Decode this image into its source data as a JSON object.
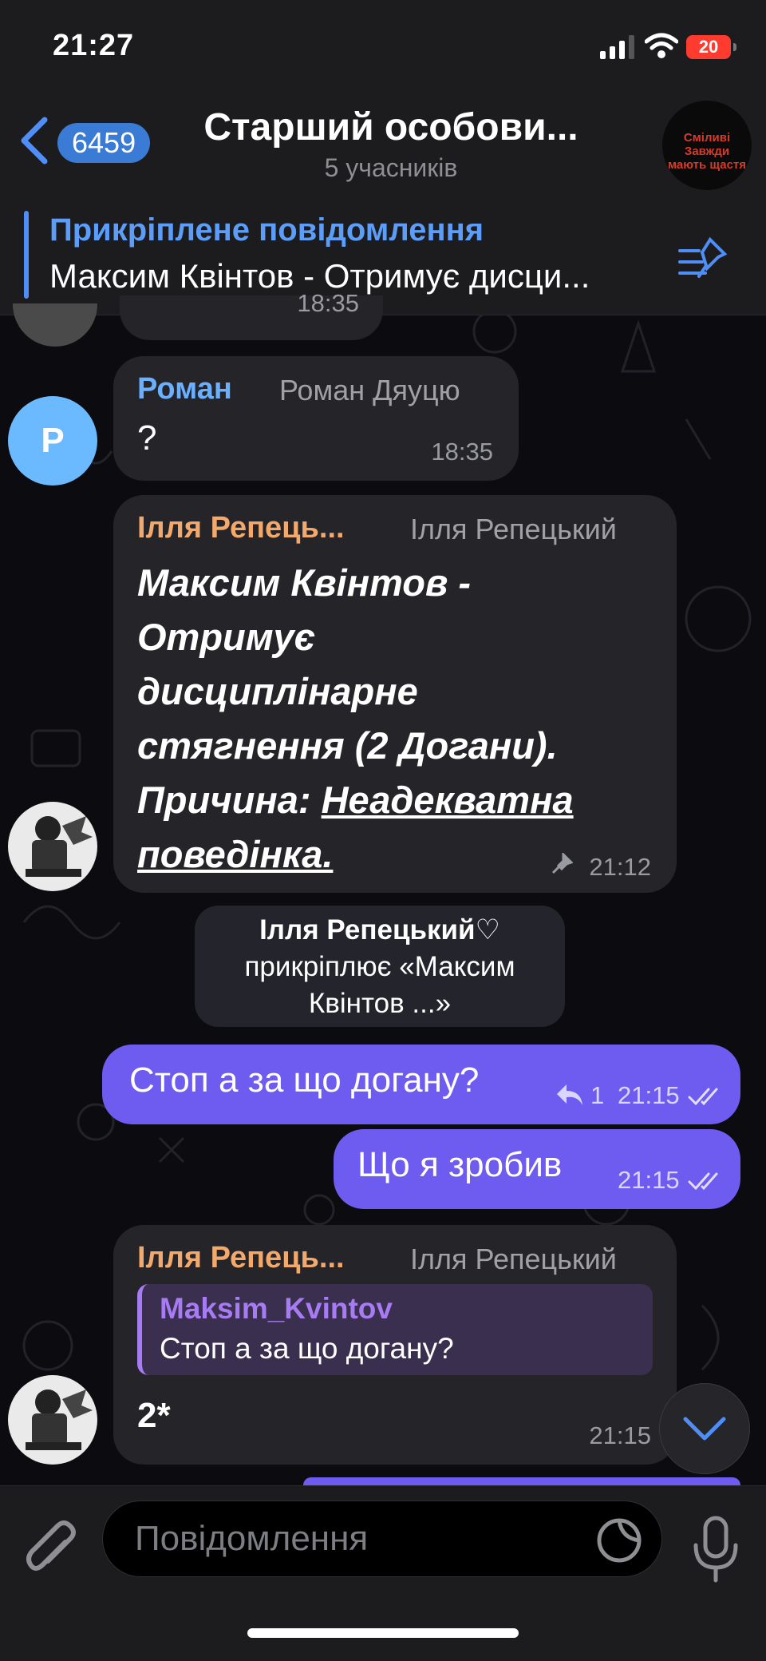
{
  "status_bar": {
    "time": "21:27",
    "battery": "20",
    "icons": [
      "signal-icon",
      "wifi-icon",
      "battery-icon"
    ]
  },
  "header": {
    "back_count": "6459",
    "title": "Старший особови...",
    "subtitle": "5 учасників",
    "avatar_text": [
      "Сміливі",
      "Завжди",
      "мають щастя"
    ]
  },
  "pinned": {
    "title": "Прикріплене повідомлення",
    "text": "Максим Квінтов - Отримує дисци..."
  },
  "messages": {
    "partial_time": "18:35",
    "roman": {
      "avatar_letter": "Р",
      "sender": "Роман",
      "sender_full": "Роман Дяуцю",
      "text": "?",
      "time": "18:35"
    },
    "pinned_msg": {
      "sender": "Ілля Репець...",
      "sender_full": "Ілля Репецький",
      "lines": [
        "Максим Квінтов -",
        "Отримує",
        "дисциплінарне",
        "стягнення (2 Догани)."
      ],
      "reason_label": "Причина:",
      "reason_part1": "Неадекватна",
      "reason_part2": "поведінка.",
      "time": "21:12"
    },
    "service": {
      "line1": "Ілля Репецький♡",
      "line2": "прикріплює «Максим",
      "line3": "Квінтов ...»"
    },
    "out1": {
      "text": "Стоп а за що догану?",
      "replies": "1",
      "time": "21:15"
    },
    "out2": {
      "text": "Що я зробив",
      "time": "21:15"
    },
    "reply_msg": {
      "sender": "Ілля Репець...",
      "sender_full": "Ілля Репецький",
      "quote_author": "Maksim_Kvintov",
      "quote_text": "Стоп а за що догану?",
      "text": "2*",
      "time": "21:15"
    }
  },
  "input": {
    "placeholder": "Повідомлення"
  },
  "colors": {
    "accent": "#3a7bd5",
    "outgoing": "#6e5bf0",
    "sender_orange": "#f2a96b",
    "sender_blue": "#6ab0ff",
    "quote_purple": "#a77bf2"
  }
}
